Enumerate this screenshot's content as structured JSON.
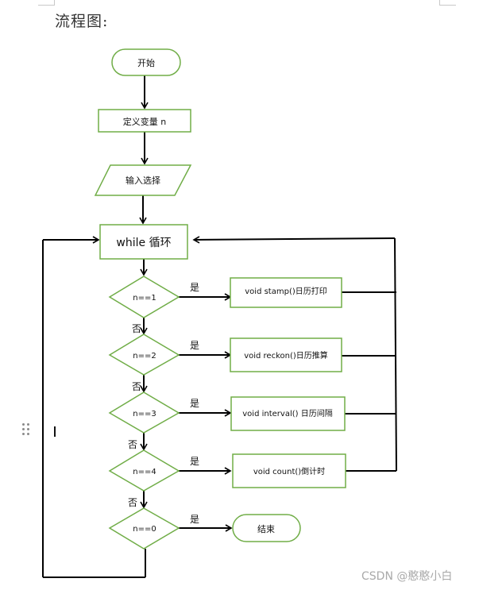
{
  "document": {
    "title": "流程图:"
  },
  "flowchart": {
    "colors": {
      "node_border": "#70ad47",
      "edge": "#000000"
    },
    "nodes": {
      "start": "开始",
      "define": "定义变量 n",
      "input": "输入选择",
      "loop": "while 循环",
      "cond1": "n==1",
      "cond2": "n==2",
      "cond3": "n==3",
      "cond4": "n==4",
      "cond0": "n==0",
      "action1": "void stamp()日历打印",
      "action2": "void reckon()日历推算",
      "action3": "void interval() 日历间隔",
      "action4": "void count()倒计时",
      "end": "结束"
    },
    "edge_labels": {
      "yes": "是",
      "no": "否"
    }
  },
  "watermark": "CSDN @憨憨小白"
}
